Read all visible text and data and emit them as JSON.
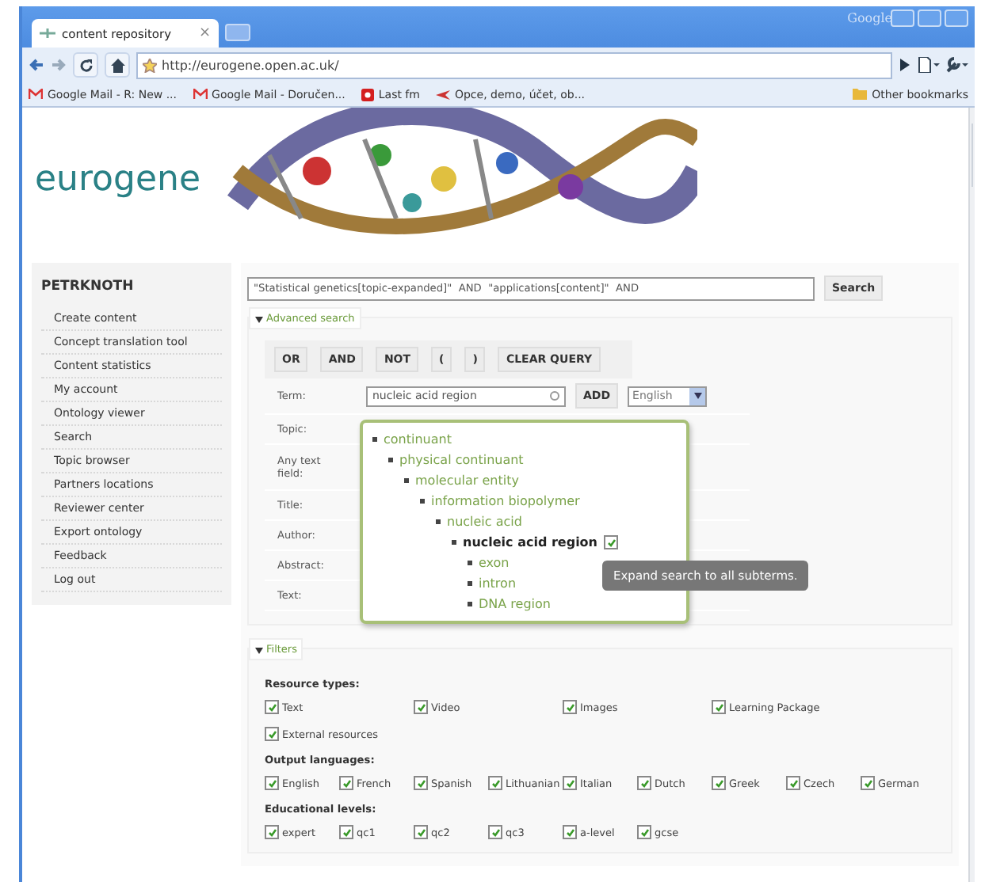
{
  "browser": {
    "brand": "Google",
    "tab": {
      "title": "content repository",
      "close": "×"
    },
    "url": "http://eurogene.open.ac.uk/",
    "bookmarks": [
      {
        "label": "Google Mail - R: New ...",
        "kind": "gmail"
      },
      {
        "label": "Google Mail - Doručen...",
        "kind": "gmail"
      },
      {
        "label": "Last fm",
        "kind": "lastfm"
      },
      {
        "label": "Opce, demo, účet, ob...",
        "kind": "arrow"
      }
    ],
    "other_bookmarks": "Other bookmarks"
  },
  "header": {
    "logo": "eurogene"
  },
  "sidebar": {
    "title": "PETRKNOTH",
    "items": [
      "Create content",
      "Concept translation tool",
      "Content statistics",
      "My account",
      "Ontology viewer",
      "Search",
      "Topic browser",
      "Partners locations",
      "Reviewer center",
      "Export ontology",
      "Feedback",
      "Log out"
    ]
  },
  "search": {
    "query": "\"Statistical genetics[topic-expanded]\"  AND  \"applications[content]\"  AND",
    "button": "Search"
  },
  "advanced": {
    "legend": "Advanced search",
    "expanded": true,
    "operators": [
      "OR",
      "AND",
      "NOT",
      "(",
      ")",
      "CLEAR QUERY"
    ],
    "term": {
      "label": "Term:",
      "value": "nucleic acid region",
      "add": "ADD",
      "language": "English"
    },
    "fields": [
      "Topic:",
      "Any text field:",
      "Title:",
      "Author:",
      "Abstract:",
      "Text:"
    ]
  },
  "tree": [
    {
      "label": "continuant",
      "selected": false,
      "children": [
        {
          "label": "physical continuant",
          "selected": false,
          "children": [
            {
              "label": "molecular entity",
              "selected": false,
              "children": [
                {
                  "label": "information biopolymer",
                  "selected": false,
                  "children": [
                    {
                      "label": "nucleic acid",
                      "selected": false,
                      "children": [
                        {
                          "label": "nucleic acid region",
                          "selected": true,
                          "checked": true,
                          "children": [
                            {
                              "label": "exon",
                              "selected": false
                            },
                            {
                              "label": "intron",
                              "selected": false
                            },
                            {
                              "label": "DNA region",
                              "selected": false
                            }
                          ]
                        }
                      ]
                    }
                  ]
                }
              ]
            }
          ]
        }
      ]
    }
  ],
  "tooltip": "Expand search to all subterms.",
  "filters": {
    "legend": "Filters",
    "expanded": true,
    "groups": [
      {
        "title": "Resource types:",
        "kind": "wide",
        "items": [
          {
            "label": "Text",
            "checked": true
          },
          {
            "label": "Video",
            "checked": true
          },
          {
            "label": "Images",
            "checked": true
          },
          {
            "label": "Learning Package",
            "checked": true
          },
          {
            "label": "External resources",
            "checked": true
          }
        ]
      },
      {
        "title": "Output languages:",
        "kind": "narrow",
        "items": [
          {
            "label": "English",
            "checked": true
          },
          {
            "label": "French",
            "checked": true
          },
          {
            "label": "Spanish",
            "checked": true
          },
          {
            "label": "Lithuanian",
            "checked": true
          },
          {
            "label": "Italian",
            "checked": true
          },
          {
            "label": "Dutch",
            "checked": true
          },
          {
            "label": "Greek",
            "checked": true
          },
          {
            "label": "Czech",
            "checked": true
          },
          {
            "label": "German",
            "checked": true
          }
        ]
      },
      {
        "title": "Educational levels:",
        "kind": "narrow",
        "items": [
          {
            "label": "expert",
            "checked": true
          },
          {
            "label": "qc1",
            "checked": true
          },
          {
            "label": "qc2",
            "checked": true
          },
          {
            "label": "qc3",
            "checked": true
          },
          {
            "label": "a-level",
            "checked": true
          },
          {
            "label": "gcse",
            "checked": true
          }
        ]
      }
    ]
  }
}
